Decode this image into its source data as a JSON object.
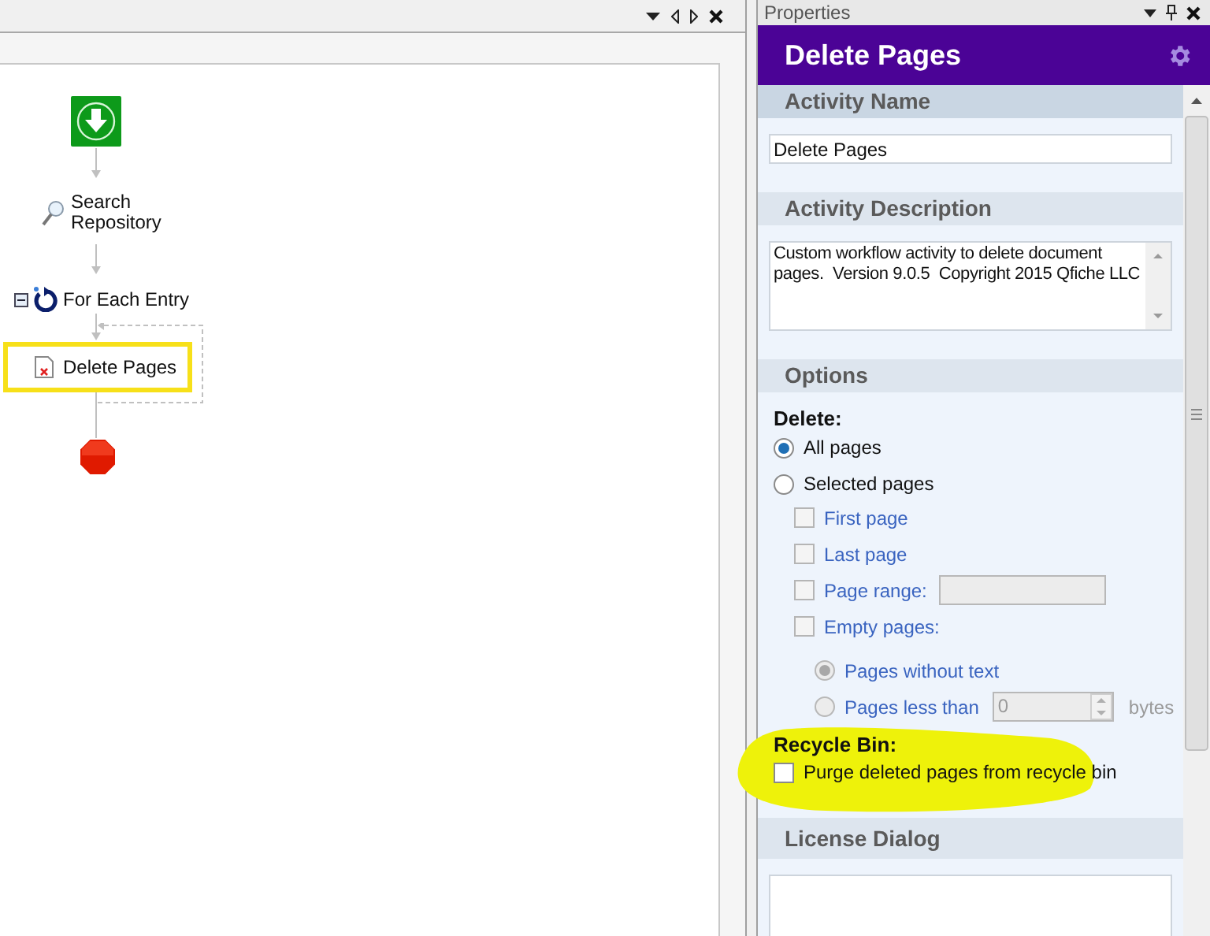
{
  "designer": {
    "nodes": [
      {
        "kind": "start"
      },
      {
        "kind": "search",
        "label": "Search\nRepository"
      },
      {
        "kind": "loop",
        "label": "For Each Entry",
        "expanded": true
      },
      {
        "kind": "delete",
        "label": "Delete Pages",
        "selected": true
      },
      {
        "kind": "stop"
      }
    ]
  },
  "properties": {
    "title": "Properties",
    "header": "Delete Pages",
    "activity_name": {
      "heading": "Activity Name",
      "value": "Delete Pages",
      "selected": true
    },
    "activity_description": {
      "heading": "Activity Description",
      "value": "Custom workflow activity to delete document pages.  Version 9.0.5  Copyright 2015 Qfiche LLC"
    },
    "options": {
      "heading": "Options",
      "delete_label": "Delete:",
      "modes": [
        {
          "label": "All pages",
          "selected": true
        },
        {
          "label": "Selected pages",
          "selected": false
        }
      ],
      "checks": [
        {
          "label": "First page",
          "checked": false,
          "disabled": true
        },
        {
          "label": "Last page",
          "checked": false,
          "disabled": true
        },
        {
          "label": "Page range:",
          "checked": false,
          "disabled": true,
          "field": true
        },
        {
          "label": "Empty pages:",
          "checked": false,
          "disabled": true
        }
      ],
      "empty_modes": [
        {
          "label": "Pages without text",
          "selected": true,
          "disabled": true
        },
        {
          "label": "Pages less than",
          "selected": false,
          "disabled": true,
          "value": "0",
          "unit": "bytes"
        }
      ],
      "recycle_label": "Recycle Bin:",
      "purge": {
        "label": "Purge deleted pages from recycle bin",
        "checked": false
      }
    },
    "license": {
      "heading": "License Dialog"
    }
  }
}
